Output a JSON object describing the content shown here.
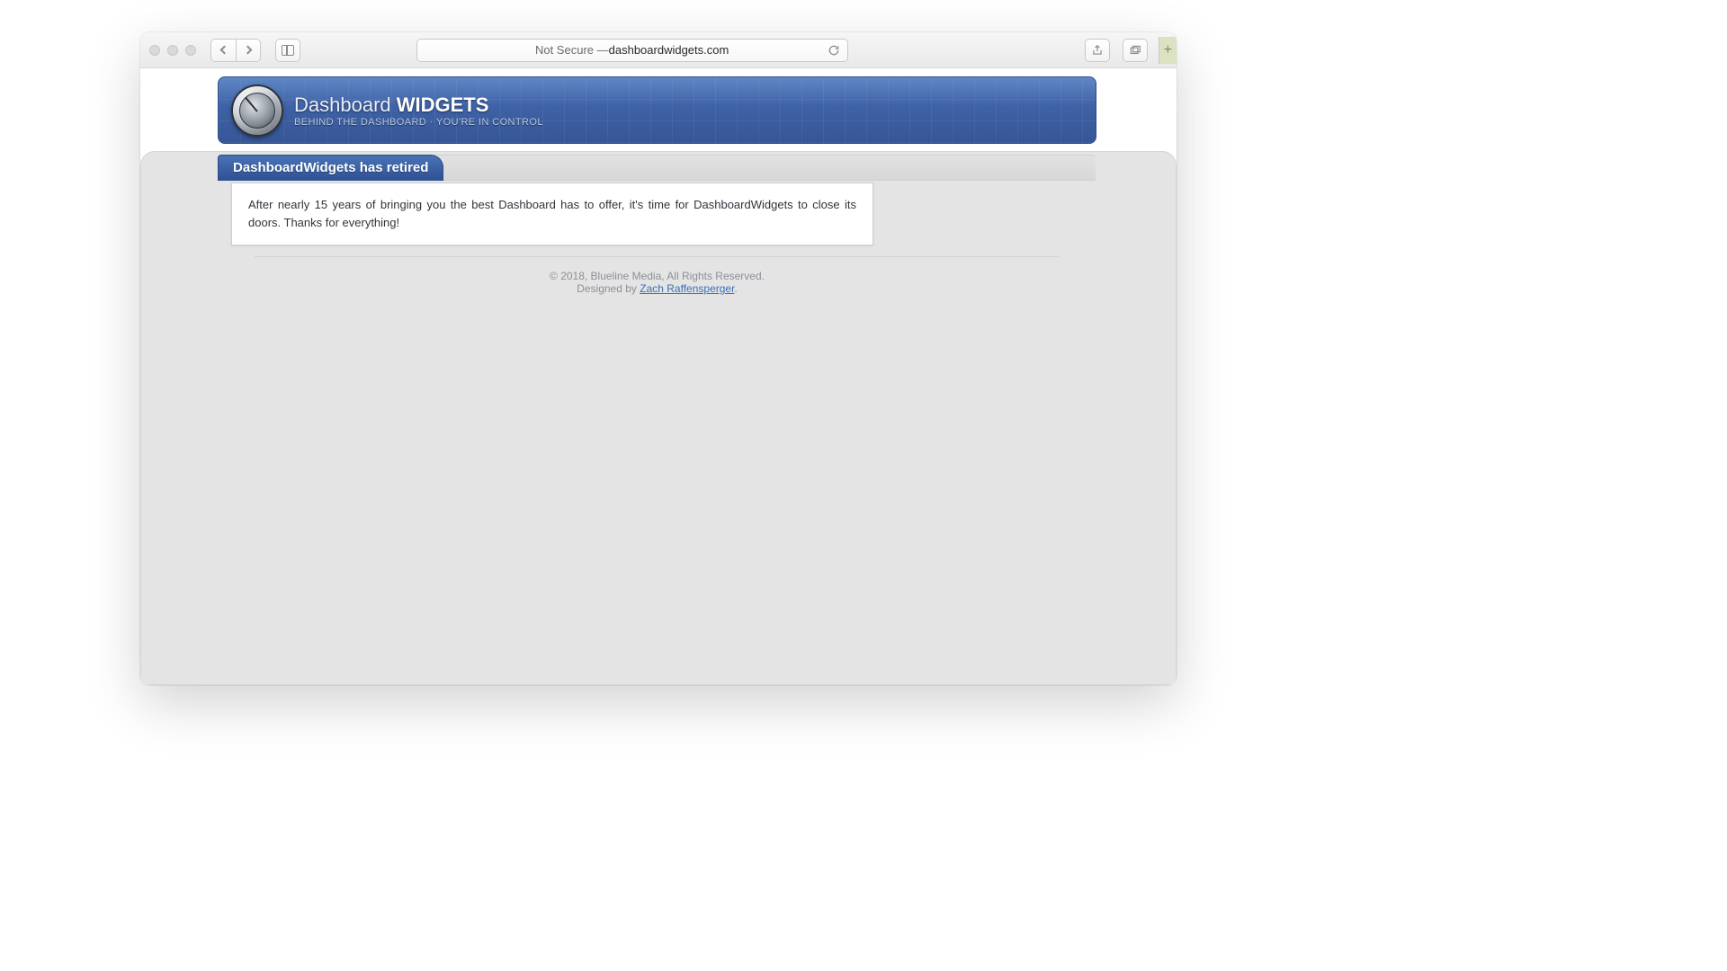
{
  "addressbar": {
    "prefix": "Not Secure — ",
    "domain": "dashboardwidgets.com"
  },
  "brand": {
    "line1_light": "Dashboard ",
    "line1_bold": "WIDGETS",
    "tagline": "BEHIND THE DASHBOARD · YOU'RE IN CONTROL"
  },
  "heading": "DashboardWidgets has retired",
  "body": "After nearly 15 years of bringing you the best Dashboard has to offer, it's time for DashboardWidgets to close its doors. Thanks for everything!",
  "footer": {
    "copyright": "© 2018, Blueline Media, All Rights Reserved.",
    "designed_prefix": "Designed by ",
    "designer": "Zach Raffensperger",
    "suffix": "."
  },
  "icons": {
    "plus": "+"
  }
}
